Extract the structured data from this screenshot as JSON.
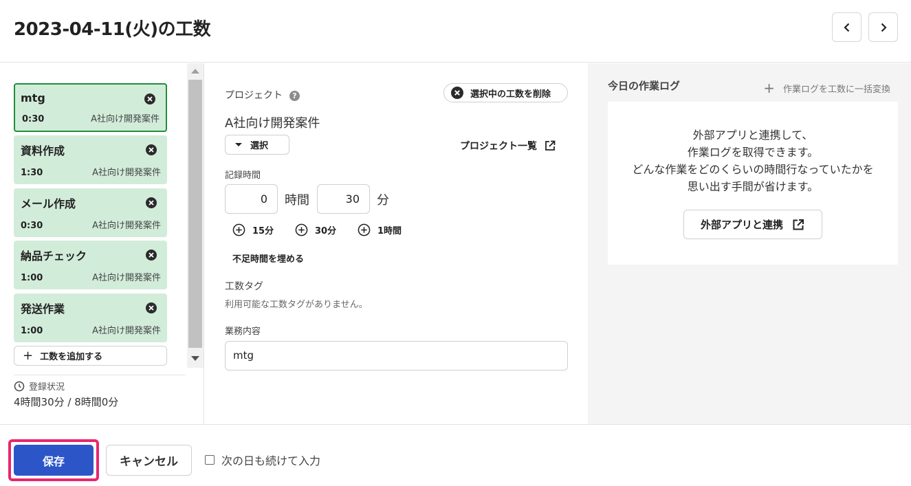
{
  "header": {
    "title": "2023-04-11(火)の工数",
    "prev_icon": "chevron-left-icon",
    "next_icon": "chevron-right-icon"
  },
  "entries": [
    {
      "name": "mtg",
      "time": "0:30",
      "project": "A社向け開発案件",
      "selected": true
    },
    {
      "name": "資料作成",
      "time": "1:30",
      "project": "A社向け開発案件",
      "selected": false
    },
    {
      "name": "メール作成",
      "time": "0:30",
      "project": "A社向け開発案件",
      "selected": false
    },
    {
      "name": "納品チェック",
      "time": "1:00",
      "project": "A社向け開発案件",
      "selected": false
    },
    {
      "name": "発送作業",
      "time": "1:00",
      "project": "A社向け開発案件",
      "selected": false
    }
  ],
  "sidebar": {
    "add_label": "工数を追加する",
    "status_label": "登録状況",
    "status_value": "4時間30分 / 8時間0分"
  },
  "form": {
    "project_label": "プロジェクト",
    "delete_label": "選択中の工数を削除",
    "project_name": "A社向け開発案件",
    "select_label": "選択",
    "project_list_label": "プロジェクト一覧",
    "time_label": "記録時間",
    "hours_value": "0",
    "hours_unit": "時間",
    "minutes_value": "30",
    "minutes_unit": "分",
    "quick_15": "15分",
    "quick_30": "30分",
    "quick_60": "1時間",
    "fill_label": "不足時間を埋める",
    "tag_label": "工数タグ",
    "tag_empty": "利用可能な工数タグがありません。",
    "task_label": "業務内容",
    "task_value": "mtg"
  },
  "worklog": {
    "title": "今日の作業ログ",
    "bulk_label": "作業ログを工数に一括変換",
    "message_lines": [
      "外部アプリと連携して、",
      "作業ログを取得できます。",
      "どんな作業をどのくらいの時間行なっていたかを",
      "思い出す手間が省けます。"
    ],
    "connect_label": "外部アプリと連携"
  },
  "footer": {
    "save_label": "保存",
    "cancel_label": "キャンセル",
    "next_day_label": "次の日も続けて入力",
    "next_day_checked": false,
    "highlight_color": "#e8266c",
    "primary_color": "#2c56c8"
  }
}
